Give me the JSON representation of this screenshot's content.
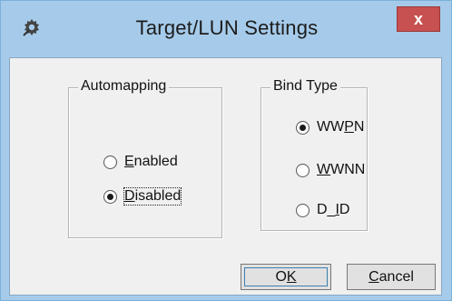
{
  "window": {
    "title": "Target/LUN Settings",
    "close_glyph": "x",
    "icon": "gear-icon"
  },
  "automapping": {
    "title": "Automapping",
    "options": [
      {
        "label_pre": "",
        "label_ul": "E",
        "label_post": "nabled",
        "checked": false
      },
      {
        "label_pre": "",
        "label_ul": "D",
        "label_post": "isabled",
        "checked": true
      }
    ]
  },
  "bind_type": {
    "title": "Bind Type",
    "options": [
      {
        "label_pre": "WW",
        "label_ul": "P",
        "label_post": "N",
        "checked": true
      },
      {
        "label_pre": "",
        "label_ul": "W",
        "label_post": "WNN",
        "checked": false
      },
      {
        "label_pre": "D_",
        "label_ul": "I",
        "label_post": "D",
        "checked": false
      }
    ]
  },
  "buttons": {
    "ok": {
      "pre": "O",
      "ul": "K",
      "post": ""
    },
    "cancel": {
      "pre": "",
      "ul": "C",
      "post": "ancel"
    }
  },
  "colors": {
    "frame": "#a6cbea",
    "close": "#c75050",
    "client": "#f0f0f0"
  }
}
